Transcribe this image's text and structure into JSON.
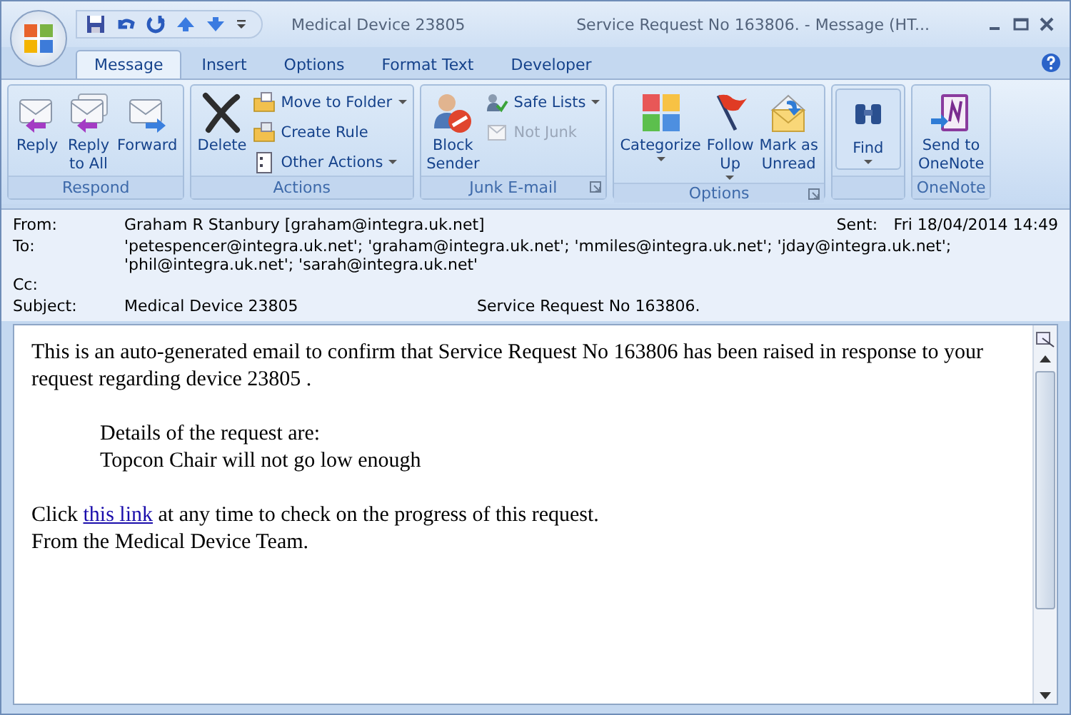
{
  "window": {
    "document_title": "Medical Device 23805",
    "title": "Service Request No 163806. - Message (HT..."
  },
  "tabs": [
    {
      "label": "Message",
      "selected": true
    },
    {
      "label": "Insert",
      "selected": false
    },
    {
      "label": "Options",
      "selected": false
    },
    {
      "label": "Format Text",
      "selected": false
    },
    {
      "label": "Developer",
      "selected": false
    }
  ],
  "ribbon": [
    {
      "name": "Respond",
      "items": [
        {
          "kind": "large",
          "label": "Reply",
          "dropdown": false,
          "disabled": false
        },
        {
          "kind": "large",
          "label": "Reply\nto All",
          "dropdown": false,
          "disabled": false
        },
        {
          "kind": "large",
          "label": "Forward",
          "dropdown": false,
          "disabled": false
        }
      ]
    },
    {
      "name": "Actions",
      "items": [
        {
          "kind": "large",
          "label": "Delete",
          "dropdown": false,
          "disabled": false
        },
        {
          "kind": "small",
          "label": "Move to Folder",
          "dropdown": true,
          "disabled": false
        },
        {
          "kind": "small",
          "label": "Create Rule",
          "dropdown": false,
          "disabled": false
        },
        {
          "kind": "small",
          "label": "Other Actions",
          "dropdown": true,
          "disabled": false
        }
      ]
    },
    {
      "name": "Junk E-mail",
      "launcher": true,
      "items": [
        {
          "kind": "large",
          "label": "Block\nSender",
          "dropdown": false,
          "disabled": false
        },
        {
          "kind": "small",
          "label": "Safe Lists",
          "dropdown": true,
          "disabled": false
        },
        {
          "kind": "small",
          "label": "Not Junk",
          "dropdown": false,
          "disabled": true
        }
      ]
    },
    {
      "name": "Options",
      "launcher": true,
      "items": [
        {
          "kind": "large",
          "label": "Categorize",
          "dropdown": true,
          "disabled": false
        },
        {
          "kind": "large",
          "label": "Follow\nUp",
          "dropdown": true,
          "disabled": false
        },
        {
          "kind": "large",
          "label": "Mark as\nUnread",
          "dropdown": false,
          "disabled": false
        }
      ]
    },
    {
      "items": [
        {
          "kind": "large",
          "label": "Find",
          "dropdown": true,
          "disabled": false
        }
      ]
    },
    {
      "name": "OneNote",
      "items": [
        {
          "kind": "large",
          "label": "Send to\nOneNote",
          "dropdown": false,
          "disabled": false
        }
      ]
    }
  ],
  "header": {
    "from_label": "From:",
    "from": "Graham R Stanbury [graham@integra.uk.net]",
    "sent_label": "Sent:",
    "sent": "Fri 18/04/2014 14:49",
    "to_label": "To:",
    "to": "'petespencer@integra.uk.net'; 'graham@integra.uk.net'; 'mmiles@integra.uk.net'; 'jday@integra.uk.net'; 'phil@integra.uk.net'; 'sarah@integra.uk.net'",
    "cc_label": "Cc:",
    "subject_label": "Subject:",
    "subject": "Medical Device 23805",
    "subject_extra": "Service Request No 163806."
  },
  "body": {
    "intro": "This is an auto-generated email to confirm that Service Request No 163806 has been raised in response to your request regarding device 23805 .",
    "details": [
      "Details of the request are:",
      "Topcon Chair will not go low enough"
    ],
    "link_before": "Click",
    "link": "this link",
    "link_after": "at any time to check on the progress of this request.",
    "closing": "From the Medical Device Team."
  }
}
